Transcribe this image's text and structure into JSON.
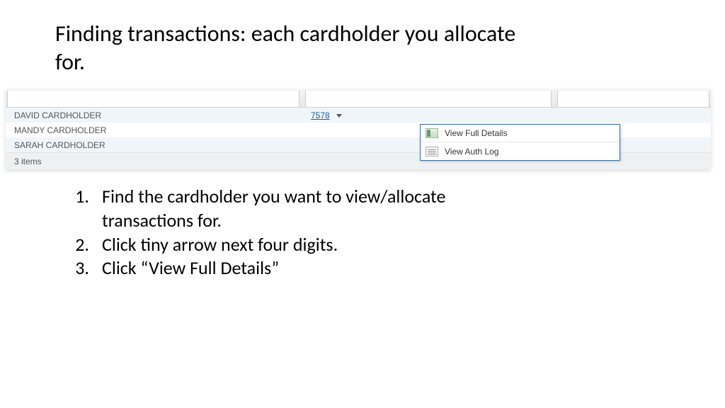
{
  "title": "Finding transactions: each cardholder you allocate for.",
  "cardholders": [
    {
      "name": "DAVID CARDHOLDER",
      "code": "7578",
      "has_dropdown": true
    },
    {
      "name": "MANDY CARDHOLDER",
      "code": "",
      "has_dropdown": false
    },
    {
      "name": "SARAH CARDHOLDER",
      "code": "",
      "has_dropdown": false
    }
  ],
  "footer_count": "3 items",
  "footer_right": "",
  "menu": {
    "view_full": "View Full Details",
    "view_auth": "View Auth Log"
  },
  "steps": [
    {
      "n": "1.",
      "text": "Find the cardholder you want to view/allocate transactions for."
    },
    {
      "n": "2.",
      "text": "Click tiny arrow next four digits."
    },
    {
      "n": "3.",
      "text": "Click “View Full Details”"
    }
  ]
}
